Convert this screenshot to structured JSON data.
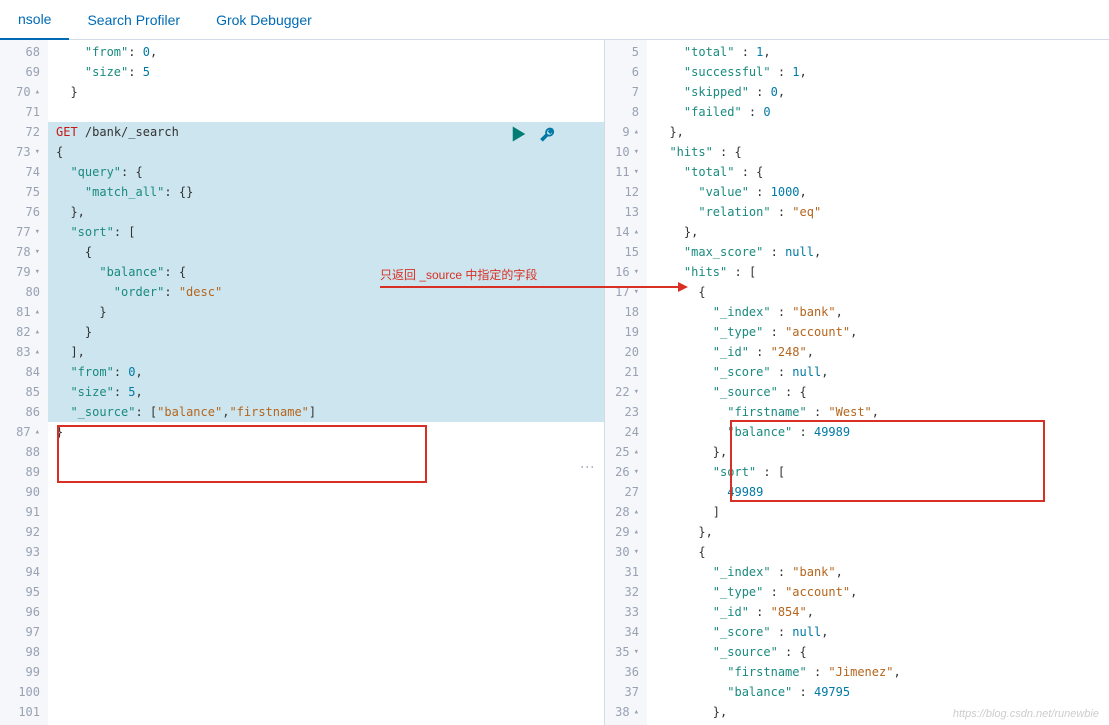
{
  "tabs": [
    {
      "label": "nsole",
      "active": true
    },
    {
      "label": "Search Profiler",
      "active": false
    },
    {
      "label": "Grok Debugger",
      "active": false
    }
  ],
  "annotation": "只返回 _source 中指定的字段",
  "watermark": "https://blog.csdn.net/runewbie",
  "left": {
    "startLine": 68,
    "lines": [
      {
        "n": 68,
        "fold": "",
        "hl": false,
        "tokens": [
          [
            "punc",
            "    "
          ],
          [
            "key",
            "\"from\""
          ],
          [
            "punc",
            ": "
          ],
          [
            "num",
            "0"
          ],
          [
            "punc",
            ","
          ]
        ]
      },
      {
        "n": 69,
        "fold": "",
        "hl": false,
        "tokens": [
          [
            "punc",
            "    "
          ],
          [
            "key",
            "\"size\""
          ],
          [
            "punc",
            ": "
          ],
          [
            "num",
            "5"
          ]
        ]
      },
      {
        "n": 70,
        "fold": "▴",
        "hl": false,
        "tokens": [
          [
            "punc",
            "  }"
          ]
        ]
      },
      {
        "n": 71,
        "fold": "",
        "hl": false,
        "tokens": []
      },
      {
        "n": 72,
        "fold": "",
        "hl": true,
        "tokens": [
          [
            "method",
            "GET"
          ],
          [
            "punc",
            " "
          ],
          [
            "path",
            "/bank/_search"
          ]
        ]
      },
      {
        "n": 73,
        "fold": "▾",
        "hl": true,
        "tokens": [
          [
            "punc",
            "{"
          ]
        ]
      },
      {
        "n": 74,
        "fold": "",
        "hl": true,
        "tokens": [
          [
            "punc",
            "  "
          ],
          [
            "key",
            "\"query\""
          ],
          [
            "punc",
            ": {"
          ]
        ]
      },
      {
        "n": 75,
        "fold": "",
        "hl": true,
        "tokens": [
          [
            "punc",
            "    "
          ],
          [
            "key",
            "\"match_all\""
          ],
          [
            "punc",
            ": {}"
          ]
        ]
      },
      {
        "n": 76,
        "fold": "",
        "hl": true,
        "tokens": [
          [
            "punc",
            "  },"
          ]
        ]
      },
      {
        "n": 77,
        "fold": "▾",
        "hl": true,
        "tokens": [
          [
            "punc",
            "  "
          ],
          [
            "key",
            "\"sort\""
          ],
          [
            "punc",
            ": ["
          ]
        ]
      },
      {
        "n": 78,
        "fold": "▾",
        "hl": true,
        "tokens": [
          [
            "punc",
            "    {"
          ]
        ]
      },
      {
        "n": 79,
        "fold": "▾",
        "hl": true,
        "tokens": [
          [
            "punc",
            "      "
          ],
          [
            "key",
            "\"balance\""
          ],
          [
            "punc",
            ": {"
          ]
        ]
      },
      {
        "n": 80,
        "fold": "",
        "hl": true,
        "tokens": [
          [
            "punc",
            "        "
          ],
          [
            "key",
            "\"order\""
          ],
          [
            "punc",
            ": "
          ],
          [
            "str",
            "\"desc\""
          ]
        ]
      },
      {
        "n": 81,
        "fold": "▴",
        "hl": true,
        "tokens": [
          [
            "punc",
            "      }"
          ]
        ]
      },
      {
        "n": 82,
        "fold": "▴",
        "hl": true,
        "tokens": [
          [
            "punc",
            "    }"
          ]
        ]
      },
      {
        "n": 83,
        "fold": "▴",
        "hl": true,
        "tokens": [
          [
            "punc",
            "  ],"
          ]
        ]
      },
      {
        "n": 84,
        "fold": "",
        "hl": true,
        "tokens": [
          [
            "punc",
            "  "
          ],
          [
            "key",
            "\"from\""
          ],
          [
            "punc",
            ": "
          ],
          [
            "num",
            "0"
          ],
          [
            "punc",
            ","
          ]
        ]
      },
      {
        "n": 85,
        "fold": "",
        "hl": true,
        "tokens": [
          [
            "punc",
            "  "
          ],
          [
            "key",
            "\"size\""
          ],
          [
            "punc",
            ": "
          ],
          [
            "num",
            "5"
          ],
          [
            "punc",
            ","
          ]
        ]
      },
      {
        "n": 86,
        "fold": "",
        "hl": true,
        "tokens": [
          [
            "punc",
            "  "
          ],
          [
            "key",
            "\"_source\""
          ],
          [
            "punc",
            ": ["
          ],
          [
            "str",
            "\"balance\""
          ],
          [
            "punc",
            ","
          ],
          [
            "str",
            "\"firstname\""
          ],
          [
            "punc",
            "]"
          ]
        ]
      },
      {
        "n": 87,
        "fold": "▴",
        "hl": false,
        "tokens": [
          [
            "punc",
            "}"
          ]
        ]
      },
      {
        "n": 88,
        "fold": "",
        "hl": false,
        "tokens": []
      },
      {
        "n": 89,
        "fold": "",
        "hl": false,
        "tokens": []
      },
      {
        "n": 90,
        "fold": "",
        "hl": false,
        "tokens": []
      },
      {
        "n": 91,
        "fold": "",
        "hl": false,
        "tokens": []
      },
      {
        "n": 92,
        "fold": "",
        "hl": false,
        "tokens": []
      },
      {
        "n": 93,
        "fold": "",
        "hl": false,
        "tokens": []
      },
      {
        "n": 94,
        "fold": "",
        "hl": false,
        "tokens": []
      },
      {
        "n": 95,
        "fold": "",
        "hl": false,
        "tokens": []
      },
      {
        "n": 96,
        "fold": "",
        "hl": false,
        "tokens": []
      },
      {
        "n": 97,
        "fold": "",
        "hl": false,
        "tokens": []
      },
      {
        "n": 98,
        "fold": "",
        "hl": false,
        "tokens": []
      },
      {
        "n": 99,
        "fold": "",
        "hl": false,
        "tokens": []
      },
      {
        "n": 100,
        "fold": "",
        "hl": false,
        "tokens": []
      },
      {
        "n": 101,
        "fold": "",
        "hl": false,
        "tokens": []
      }
    ]
  },
  "right": {
    "lines": [
      {
        "n": 5,
        "fold": "",
        "tokens": [
          [
            "punc",
            "    "
          ],
          [
            "key",
            "\"total\""
          ],
          [
            "punc",
            " : "
          ],
          [
            "num",
            "1"
          ],
          [
            "punc",
            ","
          ]
        ]
      },
      {
        "n": 6,
        "fold": "",
        "tokens": [
          [
            "punc",
            "    "
          ],
          [
            "key",
            "\"successful\""
          ],
          [
            "punc",
            " : "
          ],
          [
            "num",
            "1"
          ],
          [
            "punc",
            ","
          ]
        ]
      },
      {
        "n": 7,
        "fold": "",
        "tokens": [
          [
            "punc",
            "    "
          ],
          [
            "key",
            "\"skipped\""
          ],
          [
            "punc",
            " : "
          ],
          [
            "num",
            "0"
          ],
          [
            "punc",
            ","
          ]
        ]
      },
      {
        "n": 8,
        "fold": "",
        "tokens": [
          [
            "punc",
            "    "
          ],
          [
            "key",
            "\"failed\""
          ],
          [
            "punc",
            " : "
          ],
          [
            "num",
            "0"
          ]
        ]
      },
      {
        "n": 9,
        "fold": "▴",
        "tokens": [
          [
            "punc",
            "  },"
          ]
        ]
      },
      {
        "n": 10,
        "fold": "▾",
        "tokens": [
          [
            "punc",
            "  "
          ],
          [
            "key",
            "\"hits\""
          ],
          [
            "punc",
            " : {"
          ]
        ]
      },
      {
        "n": 11,
        "fold": "▾",
        "tokens": [
          [
            "punc",
            "    "
          ],
          [
            "key",
            "\"total\""
          ],
          [
            "punc",
            " : {"
          ]
        ]
      },
      {
        "n": 12,
        "fold": "",
        "tokens": [
          [
            "punc",
            "      "
          ],
          [
            "key",
            "\"value\""
          ],
          [
            "punc",
            " : "
          ],
          [
            "num",
            "1000"
          ],
          [
            "punc",
            ","
          ]
        ]
      },
      {
        "n": 13,
        "fold": "",
        "tokens": [
          [
            "punc",
            "      "
          ],
          [
            "key",
            "\"relation\""
          ],
          [
            "punc",
            " : "
          ],
          [
            "str",
            "\"eq\""
          ]
        ]
      },
      {
        "n": 14,
        "fold": "▴",
        "tokens": [
          [
            "punc",
            "    },"
          ]
        ]
      },
      {
        "n": 15,
        "fold": "",
        "tokens": [
          [
            "punc",
            "    "
          ],
          [
            "key",
            "\"max_score\""
          ],
          [
            "punc",
            " : "
          ],
          [
            "null",
            "null"
          ],
          [
            "punc",
            ","
          ]
        ]
      },
      {
        "n": 16,
        "fold": "▾",
        "tokens": [
          [
            "punc",
            "    "
          ],
          [
            "key",
            "\"hits\""
          ],
          [
            "punc",
            " : ["
          ]
        ]
      },
      {
        "n": 17,
        "fold": "▾",
        "tokens": [
          [
            "punc",
            "      {"
          ]
        ]
      },
      {
        "n": 18,
        "fold": "",
        "tokens": [
          [
            "punc",
            "        "
          ],
          [
            "key",
            "\"_index\""
          ],
          [
            "punc",
            " : "
          ],
          [
            "str",
            "\"bank\""
          ],
          [
            "punc",
            ","
          ]
        ]
      },
      {
        "n": 19,
        "fold": "",
        "tokens": [
          [
            "punc",
            "        "
          ],
          [
            "key",
            "\"_type\""
          ],
          [
            "punc",
            " : "
          ],
          [
            "str",
            "\"account\""
          ],
          [
            "punc",
            ","
          ]
        ]
      },
      {
        "n": 20,
        "fold": "",
        "tokens": [
          [
            "punc",
            "        "
          ],
          [
            "key",
            "\"_id\""
          ],
          [
            "punc",
            " : "
          ],
          [
            "str",
            "\"248\""
          ],
          [
            "punc",
            ","
          ]
        ]
      },
      {
        "n": 21,
        "fold": "",
        "tokens": [
          [
            "punc",
            "        "
          ],
          [
            "key",
            "\"_score\""
          ],
          [
            "punc",
            " : "
          ],
          [
            "null",
            "null"
          ],
          [
            "punc",
            ","
          ]
        ]
      },
      {
        "n": 22,
        "fold": "▾",
        "tokens": [
          [
            "punc",
            "        "
          ],
          [
            "key",
            "\"_source\""
          ],
          [
            "punc",
            " : {"
          ]
        ]
      },
      {
        "n": 23,
        "fold": "",
        "tokens": [
          [
            "punc",
            "          "
          ],
          [
            "key",
            "\"firstname\""
          ],
          [
            "punc",
            " : "
          ],
          [
            "str",
            "\"West\""
          ],
          [
            "punc",
            ","
          ]
        ]
      },
      {
        "n": 24,
        "fold": "",
        "tokens": [
          [
            "punc",
            "          "
          ],
          [
            "key",
            "\"balance\""
          ],
          [
            "punc",
            " : "
          ],
          [
            "num",
            "49989"
          ]
        ]
      },
      {
        "n": 25,
        "fold": "▴",
        "tokens": [
          [
            "punc",
            "        },"
          ]
        ]
      },
      {
        "n": 26,
        "fold": "▾",
        "tokens": [
          [
            "punc",
            "        "
          ],
          [
            "key",
            "\"sort\""
          ],
          [
            "punc",
            " : ["
          ]
        ]
      },
      {
        "n": 27,
        "fold": "",
        "tokens": [
          [
            "punc",
            "          "
          ],
          [
            "num",
            "49989"
          ]
        ]
      },
      {
        "n": 28,
        "fold": "▴",
        "tokens": [
          [
            "punc",
            "        ]"
          ]
        ]
      },
      {
        "n": 29,
        "fold": "▴",
        "tokens": [
          [
            "punc",
            "      },"
          ]
        ]
      },
      {
        "n": 30,
        "fold": "▾",
        "tokens": [
          [
            "punc",
            "      {"
          ]
        ]
      },
      {
        "n": 31,
        "fold": "",
        "tokens": [
          [
            "punc",
            "        "
          ],
          [
            "key",
            "\"_index\""
          ],
          [
            "punc",
            " : "
          ],
          [
            "str",
            "\"bank\""
          ],
          [
            "punc",
            ","
          ]
        ]
      },
      {
        "n": 32,
        "fold": "",
        "tokens": [
          [
            "punc",
            "        "
          ],
          [
            "key",
            "\"_type\""
          ],
          [
            "punc",
            " : "
          ],
          [
            "str",
            "\"account\""
          ],
          [
            "punc",
            ","
          ]
        ]
      },
      {
        "n": 33,
        "fold": "",
        "tokens": [
          [
            "punc",
            "        "
          ],
          [
            "key",
            "\"_id\""
          ],
          [
            "punc",
            " : "
          ],
          [
            "str",
            "\"854\""
          ],
          [
            "punc",
            ","
          ]
        ]
      },
      {
        "n": 34,
        "fold": "",
        "tokens": [
          [
            "punc",
            "        "
          ],
          [
            "key",
            "\"_score\""
          ],
          [
            "punc",
            " : "
          ],
          [
            "null",
            "null"
          ],
          [
            "punc",
            ","
          ]
        ]
      },
      {
        "n": 35,
        "fold": "▾",
        "tokens": [
          [
            "punc",
            "        "
          ],
          [
            "key",
            "\"_source\""
          ],
          [
            "punc",
            " : {"
          ]
        ]
      },
      {
        "n": 36,
        "fold": "",
        "tokens": [
          [
            "punc",
            "          "
          ],
          [
            "key",
            "\"firstname\""
          ],
          [
            "punc",
            " : "
          ],
          [
            "str",
            "\"Jimenez\""
          ],
          [
            "punc",
            ","
          ]
        ]
      },
      {
        "n": 37,
        "fold": "",
        "tokens": [
          [
            "punc",
            "          "
          ],
          [
            "key",
            "\"balance\""
          ],
          [
            "punc",
            " : "
          ],
          [
            "num",
            "49795"
          ]
        ]
      },
      {
        "n": 38,
        "fold": "▴",
        "tokens": [
          [
            "punc",
            "        },"
          ]
        ]
      }
    ]
  }
}
